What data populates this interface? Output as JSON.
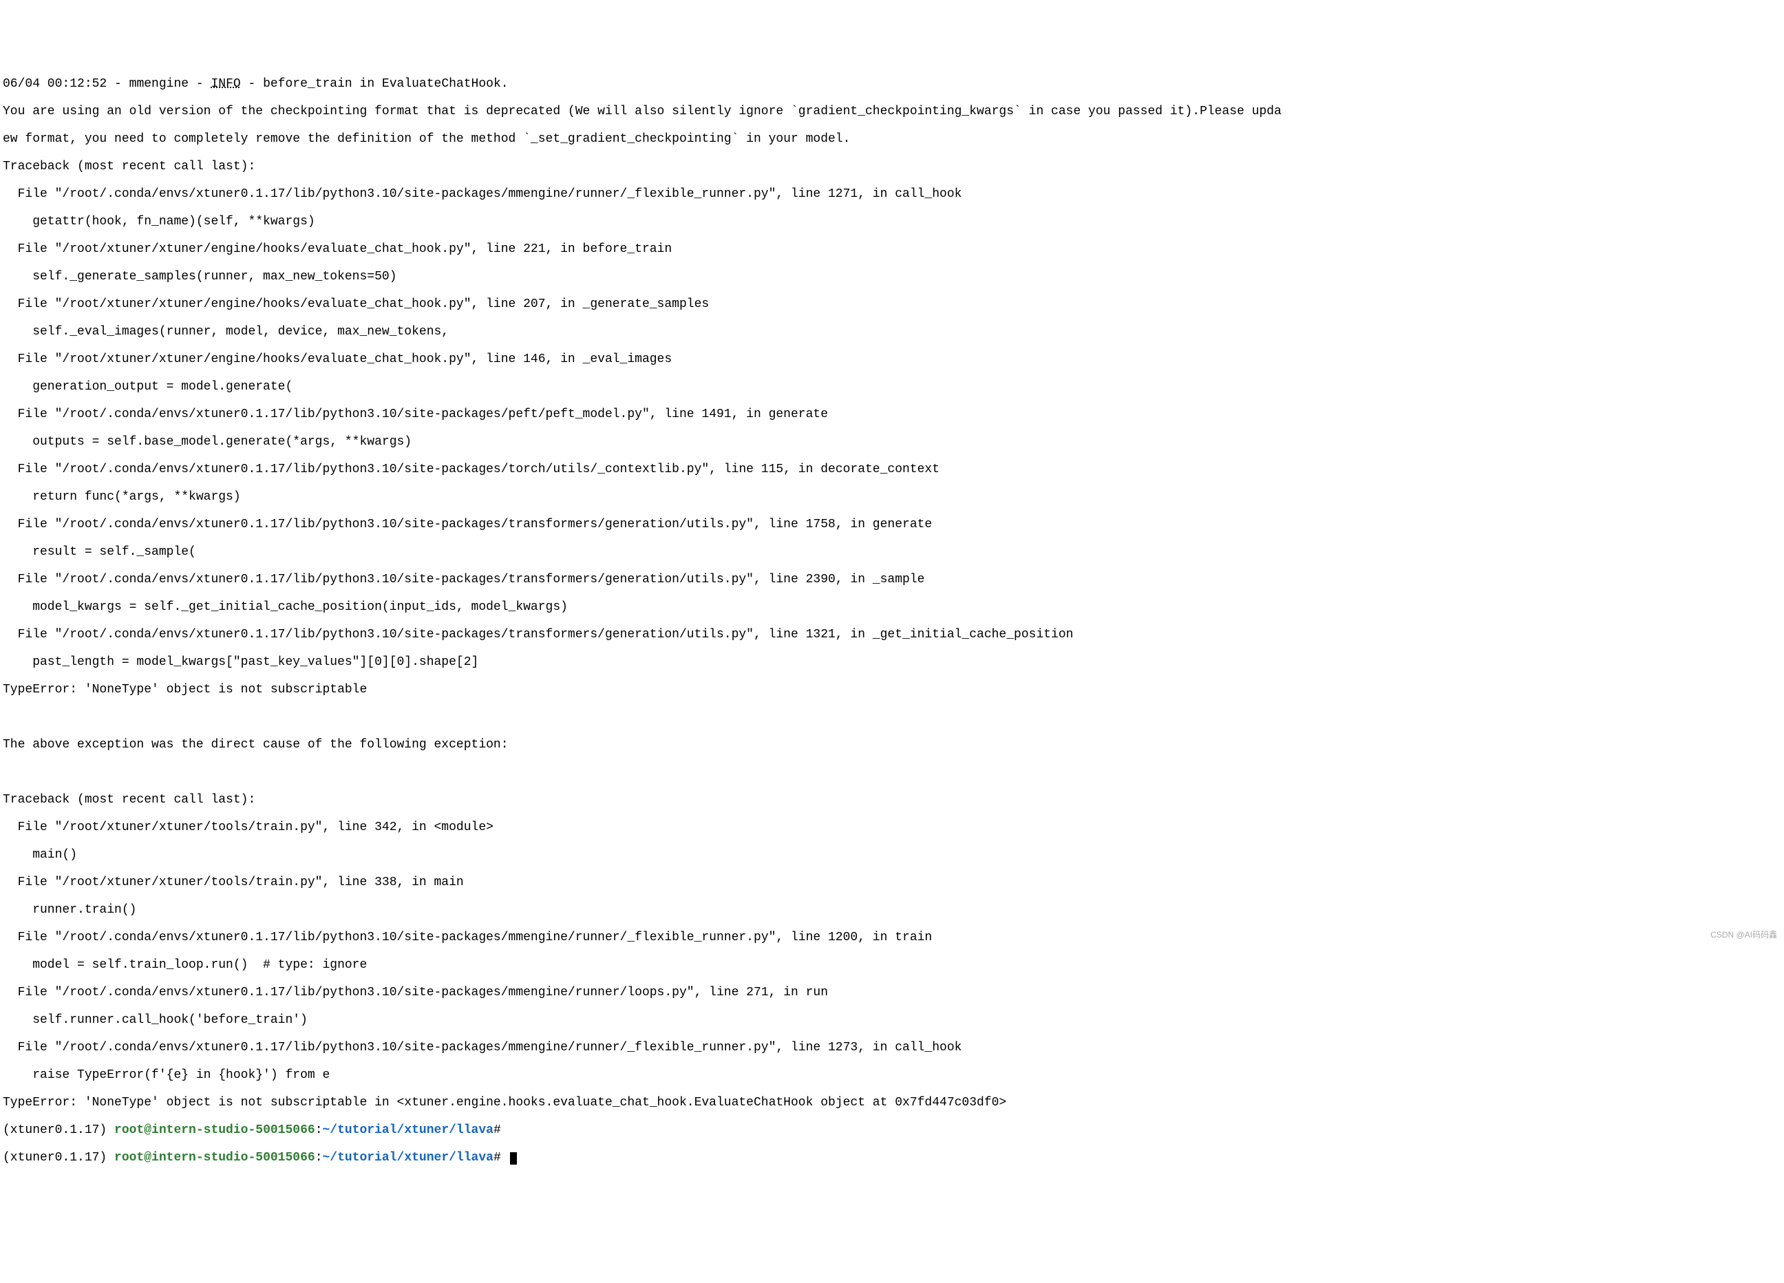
{
  "log_header": {
    "timestamp": "06/04 00:12:52",
    "separator1": " - ",
    "module": "mmengine",
    "separator2": " - ",
    "level": "INFO",
    "separator3": " - ",
    "message": "before_train in EvaluateChatHook."
  },
  "warning_line1": "You are using an old version of the checkpointing format that is deprecated (We will also silently ignore `gradient_checkpointing_kwargs` in case you passed it).Please upda",
  "warning_line2": "ew format, you need to completely remove the definition of the method `_set_gradient_checkpointing` in your model.",
  "traceback1": {
    "header": "Traceback (most recent call last):",
    "lines": [
      "  File \"/root/.conda/envs/xtuner0.1.17/lib/python3.10/site-packages/mmengine/runner/_flexible_runner.py\", line 1271, in call_hook",
      "    getattr(hook, fn_name)(self, **kwargs)",
      "  File \"/root/xtuner/xtuner/engine/hooks/evaluate_chat_hook.py\", line 221, in before_train",
      "    self._generate_samples(runner, max_new_tokens=50)",
      "  File \"/root/xtuner/xtuner/engine/hooks/evaluate_chat_hook.py\", line 207, in _generate_samples",
      "    self._eval_images(runner, model, device, max_new_tokens,",
      "  File \"/root/xtuner/xtuner/engine/hooks/evaluate_chat_hook.py\", line 146, in _eval_images",
      "    generation_output = model.generate(",
      "  File \"/root/.conda/envs/xtuner0.1.17/lib/python3.10/site-packages/peft/peft_model.py\", line 1491, in generate",
      "    outputs = self.base_model.generate(*args, **kwargs)",
      "  File \"/root/.conda/envs/xtuner0.1.17/lib/python3.10/site-packages/torch/utils/_contextlib.py\", line 115, in decorate_context",
      "    return func(*args, **kwargs)",
      "  File \"/root/.conda/envs/xtuner0.1.17/lib/python3.10/site-packages/transformers/generation/utils.py\", line 1758, in generate",
      "    result = self._sample(",
      "  File \"/root/.conda/envs/xtuner0.1.17/lib/python3.10/site-packages/transformers/generation/utils.py\", line 2390, in _sample",
      "    model_kwargs = self._get_initial_cache_position(input_ids, model_kwargs)",
      "  File \"/root/.conda/envs/xtuner0.1.17/lib/python3.10/site-packages/transformers/generation/utils.py\", line 1321, in _get_initial_cache_position",
      "    past_length = model_kwargs[\"past_key_values\"][0][0].shape[2]"
    ],
    "error": "TypeError: 'NoneType' object is not subscriptable"
  },
  "separator": "The above exception was the direct cause of the following exception:",
  "traceback2": {
    "header": "Traceback (most recent call last):",
    "lines": [
      "  File \"/root/xtuner/xtuner/tools/train.py\", line 342, in <module>",
      "    main()",
      "  File \"/root/xtuner/xtuner/tools/train.py\", line 338, in main",
      "    runner.train()",
      "  File \"/root/.conda/envs/xtuner0.1.17/lib/python3.10/site-packages/mmengine/runner/_flexible_runner.py\", line 1200, in train",
      "    model = self.train_loop.run()  # type: ignore",
      "  File \"/root/.conda/envs/xtuner0.1.17/lib/python3.10/site-packages/mmengine/runner/loops.py\", line 271, in run",
      "    self.runner.call_hook('before_train')",
      "  File \"/root/.conda/envs/xtuner0.1.17/lib/python3.10/site-packages/mmengine/runner/_flexible_runner.py\", line 1273, in call_hook",
      "    raise TypeError(f'{e} in {hook}') from e"
    ],
    "error": "TypeError: 'NoneType' object is not subscriptable in <xtuner.engine.hooks.evaluate_chat_hook.EvaluateChatHook object at 0x7fd447c03df0>"
  },
  "prompt": {
    "env": "(xtuner0.1.17) ",
    "user_host": "root@intern-studio-50015066",
    "colon": ":",
    "path": "~/tutorial/xtuner/llava",
    "hash": "#"
  },
  "watermark": "CSDN @AI码码鑫"
}
